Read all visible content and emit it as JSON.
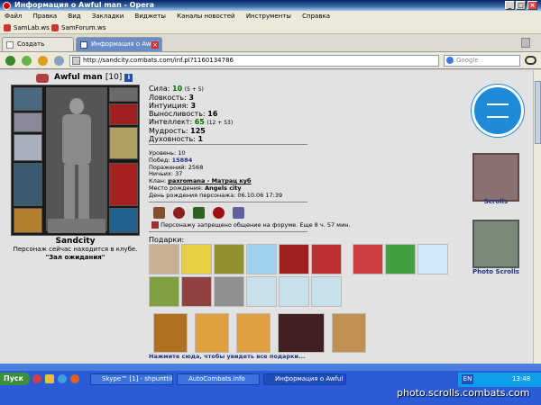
{
  "window": {
    "title": "Информация о Awful man - Opera"
  },
  "menu": {
    "items": [
      "Файл",
      "Правка",
      "Вид",
      "Закладки",
      "Виджеты",
      "Каналы новостей",
      "Инструменты",
      "Справка"
    ]
  },
  "bookmarks": {
    "items": [
      "SamLab.ws",
      "SamForum.ws"
    ]
  },
  "tabs": [
    {
      "label": "Создать вкладку"
    },
    {
      "label": "Информация о Awful man"
    }
  ],
  "address": {
    "url": "http://sandcity.combats.com/inf.pl?1160134786",
    "search_placeholder": "Google"
  },
  "character": {
    "name": "Awful man",
    "level": "[10]",
    "clan_badge": "i"
  },
  "stats": [
    {
      "label": "Сила:",
      "value": "10",
      "extra": "(5 + 5)",
      "green": true
    },
    {
      "label": "Ловкость:",
      "value": "3",
      "extra": ""
    },
    {
      "label": "Интуиция:",
      "value": "3",
      "extra": ""
    },
    {
      "label": "Выносливость:",
      "value": "16",
      "extra": ""
    },
    {
      "label": "Интеллект:",
      "value": "65",
      "extra": "(12 + 53)",
      "green": true
    },
    {
      "label": "Мудрость:",
      "value": "125",
      "extra": ""
    },
    {
      "label": "Духовность:",
      "value": "1",
      "extra": ""
    }
  ],
  "info": {
    "level": "Уровень: 10",
    "wins_label": "Побед:",
    "wins": "15884",
    "losses": "Поражений: 2568",
    "draws": "Ничьих: 37",
    "clan_label": "Клан:",
    "clan": "paxromana - Матрац куб",
    "birthplace_label": "Место рождения:",
    "birthplace": "Angels city",
    "birthday": "День рождения персонажа: 06.10.06 17:39"
  },
  "forum_ban": "Персонажу запрещено общение на форуме. Еще 8 ч. 57 мин.",
  "location": {
    "city": "Sandcity",
    "text": "Персонаж сейчас находится в клубе.",
    "room": "\"Зал ожидания\""
  },
  "gifts": {
    "label": "Подарки:",
    "more_link": "Нажмите сюда, чтобы увидеть все подарки..."
  },
  "right_panel": {
    "scrolls_label": "Scrolls",
    "photo_scrolls_label": "Photo Scrolls"
  },
  "taskbar": {
    "start": "Пуск",
    "items": [
      "Skype™ [1] - shpunttik",
      "AutoCombats.info",
      "Информация о Awful ..."
    ],
    "lang": "EN",
    "time": "13:48"
  },
  "watermark": "photo.scrolls.combats.com",
  "colors": {
    "titlebar": "#0a246a",
    "taskbar": "#2b5bd6",
    "page_bg": "#e2e2e2",
    "stat_green": "#007000"
  }
}
